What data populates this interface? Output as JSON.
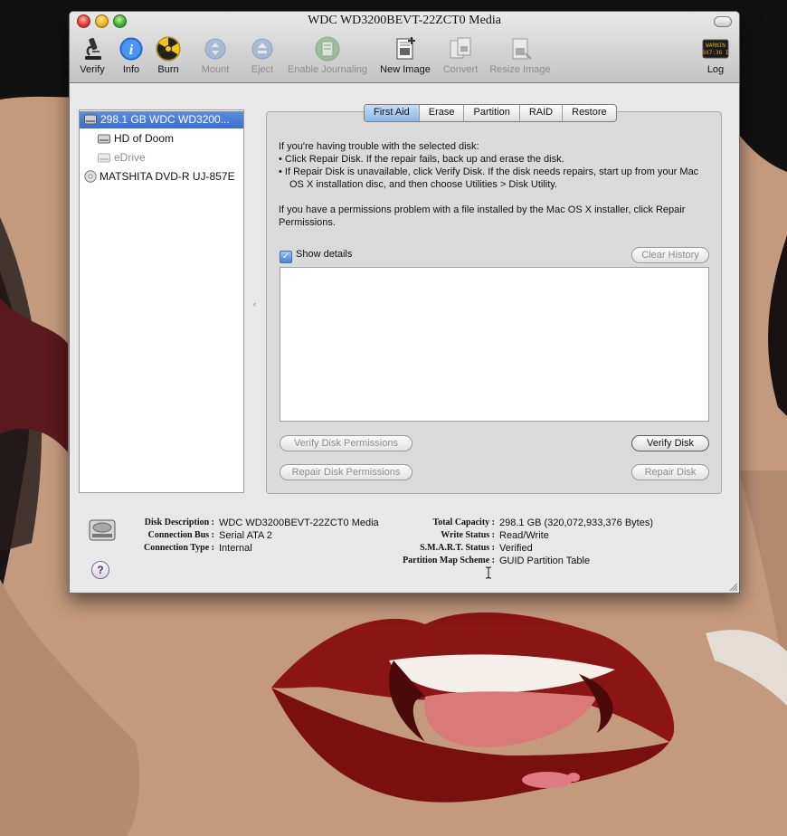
{
  "window": {
    "title": "WDC WD3200BEVT-22ZCT0 Media"
  },
  "toolbar": {
    "items": [
      {
        "label": "Verify",
        "icon": "microscope-icon",
        "enabled": true
      },
      {
        "label": "Info",
        "icon": "info-icon",
        "enabled": true
      },
      {
        "label": "Burn",
        "icon": "burn-icon",
        "enabled": true
      },
      {
        "label": "Mount",
        "icon": "mount-icon",
        "enabled": false
      },
      {
        "label": "Eject",
        "icon": "eject-icon",
        "enabled": false
      },
      {
        "label": "Enable Journaling",
        "icon": "journaling-icon",
        "enabled": false
      },
      {
        "label": "New Image",
        "icon": "new-image-icon",
        "enabled": true
      },
      {
        "label": "Convert",
        "icon": "convert-icon",
        "enabled": false
      },
      {
        "label": "Resize Image",
        "icon": "resize-image-icon",
        "enabled": false
      },
      {
        "label": "Log",
        "icon": "log-icon",
        "enabled": true
      }
    ],
    "log_icon_text": [
      "WARNIN",
      "9X7:36 I"
    ]
  },
  "sidebar": {
    "items": [
      {
        "label": "298.1 GB WDC WD3200...",
        "selected": true,
        "dim": false,
        "icon": "hard-disk-icon"
      },
      {
        "label": "HD of Doom",
        "selected": false,
        "dim": false,
        "icon": "volume-icon"
      },
      {
        "label": "eDrive",
        "selected": false,
        "dim": true,
        "icon": "volume-icon"
      },
      {
        "label": "MATSHITA DVD-R UJ-857E",
        "selected": false,
        "dim": false,
        "icon": "optical-drive-icon"
      }
    ]
  },
  "tabs": [
    {
      "label": "First Aid",
      "active": true
    },
    {
      "label": "Erase",
      "active": false
    },
    {
      "label": "Partition",
      "active": false
    },
    {
      "label": "RAID",
      "active": false
    },
    {
      "label": "Restore",
      "active": false
    }
  ],
  "first_aid": {
    "intro": "If you're having trouble with the selected disk:",
    "bullet1": "• Click Repair Disk. If the repair fails, back up and erase the disk.",
    "bullet2": "• If Repair Disk is unavailable, click Verify Disk. If the disk needs repairs, start up from your Mac OS X installation disc, and then choose Utilities > Disk Utility.",
    "permissions": "If you have a permissions problem with a file installed by the Mac OS X installer, click Repair Permissions.",
    "show_details_label": "Show details",
    "show_details_checked": "✓",
    "clear_history": "Clear History",
    "verify_permissions": "Verify Disk Permissions",
    "repair_permissions": "Repair Disk Permissions",
    "verify_disk": "Verify Disk",
    "repair_disk": "Repair Disk"
  },
  "disk_info": {
    "left": [
      {
        "key": "Disk Description :",
        "value": "WDC WD3200BEVT-22ZCT0 Media"
      },
      {
        "key": "Connection Bus :",
        "value": "Serial ATA 2"
      },
      {
        "key": "Connection Type :",
        "value": "Internal"
      }
    ],
    "right": [
      {
        "key": "Total Capacity :",
        "value": "298.1 GB (320,072,933,376 Bytes)"
      },
      {
        "key": "Write Status :",
        "value": "Read/Write"
      },
      {
        "key": "S.M.A.R.T. Status :",
        "value": "Verified"
      },
      {
        "key": "Partition Map Scheme :",
        "value": "GUID Partition Table"
      }
    ],
    "help": "?"
  },
  "colors": {
    "accent": "#3b6fcf",
    "tab_active": "#8cb6ea",
    "skin": "#c49a7e",
    "lips": "#8b1414"
  }
}
